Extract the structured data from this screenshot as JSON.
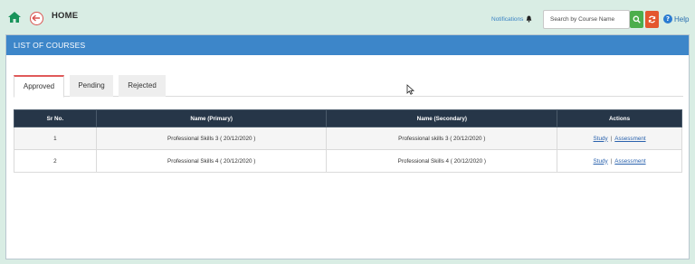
{
  "header": {
    "title": "HOME",
    "notifications_label": "Notifications",
    "search_placeholder": "Search by Course Name",
    "help_label": "Help"
  },
  "card": {
    "title": "LIST OF COURSES"
  },
  "tabs": [
    {
      "label": "Approved",
      "active": true
    },
    {
      "label": "Pending",
      "active": false
    },
    {
      "label": "Rejected",
      "active": false
    }
  ],
  "table": {
    "headers": [
      "Sr No.",
      "Name (Primary)",
      "Name (Secondary)",
      "Actions"
    ],
    "rows": [
      {
        "sr": "1",
        "primary": "Professional Skills 3 ( 20/12/2020 )",
        "secondary": "Professional skills 3 ( 20/12/2020 )",
        "study": "Study",
        "assessment": "Assessment"
      },
      {
        "sr": "2",
        "primary": "Professional Skills 4 ( 20/12/2020 )",
        "secondary": "Professional Skills 4 ( 20/12/2020 )",
        "study": "Study",
        "assessment": "Assessment"
      }
    ],
    "action_separator": "|"
  },
  "colors": {
    "background": "#d9ede4",
    "header_blue": "#3d86c9",
    "table_header": "#263648",
    "active_tab_accent": "#e05a5a",
    "search_button": "#4cae4c",
    "refresh_button": "#e4572e"
  },
  "icons": {
    "home": "home-icon",
    "back": "back-arrow-icon",
    "bell": "bell-icon",
    "search": "search-icon",
    "refresh": "refresh-icon",
    "help": "question-circle-icon"
  }
}
